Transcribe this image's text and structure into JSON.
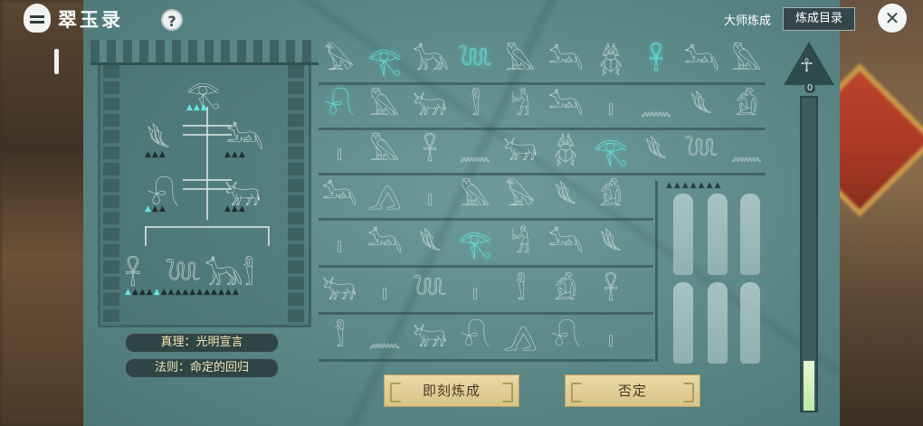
{
  "header": {
    "app_title": "翠玉录",
    "help_label": "?",
    "master_label": "大师炼成",
    "catalog_label": "炼成目录",
    "close_label": "✕"
  },
  "tree": {
    "top_glyph": "𓂀",
    "left_glyph": "𓆰",
    "right_glyph": "𓃢",
    "mid_left_glyph": "𓍯",
    "mid_right_glyph": "𓃒",
    "bottom_glyphs": [
      "𓋹",
      "𓆙",
      "𓃥",
      "𓀾"
    ]
  },
  "rules": {
    "truth": "真理：光明宣言",
    "law": "法则：命定的回归"
  },
  "grid": {
    "rows": [
      [
        "𓅃",
        "𓂀",
        "𓃥",
        "𓆙",
        "𓅓",
        "𓃢",
        "𓆣",
        "𓋹",
        "𓃢",
        "𓅓"
      ],
      [
        "𓍯",
        "𓅓",
        "𓃒",
        "𓀾",
        "𓀜",
        "𓃢",
        "𓏤",
        "𓈖",
        "𓆰",
        "𓀁"
      ],
      [
        "𓏤",
        "𓅓",
        "𓋹",
        "𓈖",
        "𓃒",
        "𓆣",
        "𓂀",
        "𓆰",
        "𓆙",
        "𓈖"
      ],
      [
        "𓃢",
        "𓂻",
        "𓏤",
        "𓅓",
        "𓅃",
        "𓆰",
        "𓀁"
      ],
      [
        "𓏤",
        "𓃢",
        "𓆰",
        "𓂀",
        "𓀜",
        "𓃢",
        "𓆰"
      ],
      [
        "𓃒",
        "𓏤",
        "𓆙",
        "𓏤",
        "𓀾",
        "𓀁",
        "𓋹"
      ],
      [
        "𓀾",
        "𓈖",
        "𓃒",
        "𓍯",
        "𓂻",
        "𓍯",
        "𓏤"
      ]
    ],
    "highlighted": [
      "0-1",
      "0-3",
      "0-7",
      "1-0",
      "2-6",
      "4-3"
    ]
  },
  "progress": {
    "level": "0",
    "fill_fraction": 0.16
  },
  "actions": {
    "transmute": "即刻炼成",
    "deny": "否定"
  }
}
